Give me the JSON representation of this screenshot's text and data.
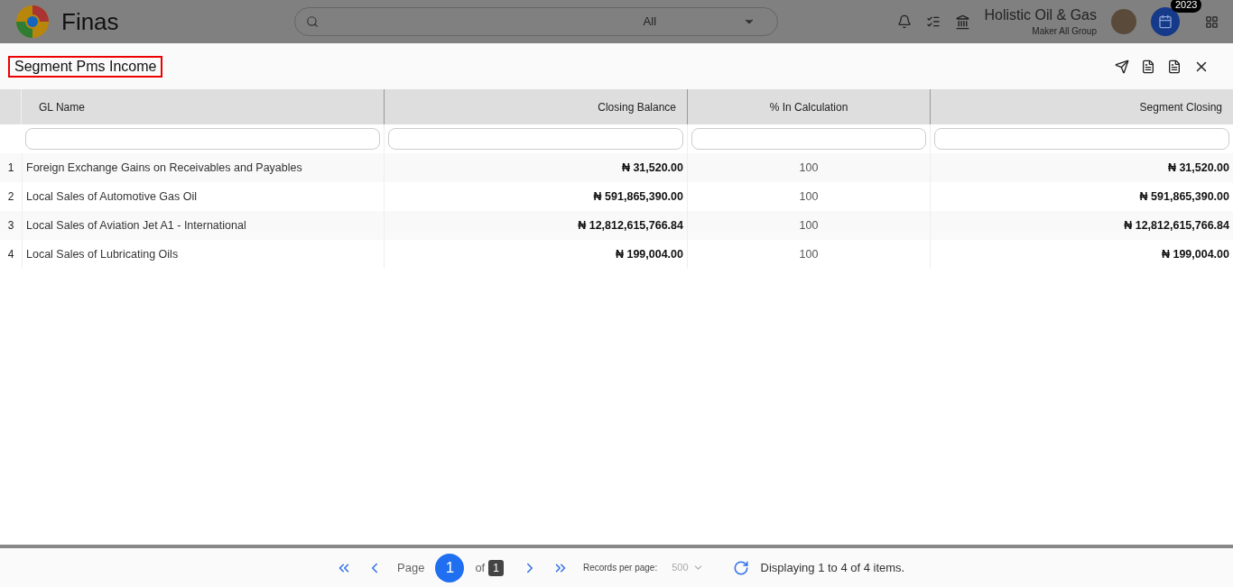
{
  "app": {
    "name": "Finas"
  },
  "search": {
    "scope": "All"
  },
  "company": {
    "name": "Holistic Oil & Gas",
    "group": "Maker All Group"
  },
  "year_badge": "2023",
  "panel": {
    "title": "Segment Pms Income"
  },
  "table": {
    "columns": [
      {
        "label": "GL Name",
        "kind": "text"
      },
      {
        "label": "Closing Balance",
        "kind": "amount"
      },
      {
        "label": "% In Calculation",
        "kind": "percent"
      },
      {
        "label": "Segment Closing",
        "kind": "amount"
      }
    ],
    "rows": [
      {
        "index": "1",
        "cells": [
          "Foreign Exchange Gains on Receivables and Payables",
          "₦ 31,520.00",
          "100",
          "₦ 31,520.00"
        ]
      },
      {
        "index": "2",
        "cells": [
          "Local Sales of Automotive Gas Oil",
          "₦ 591,865,390.00",
          "100",
          "₦ 591,865,390.00"
        ]
      },
      {
        "index": "3",
        "cells": [
          "Local Sales of Aviation Jet A1 - International",
          "₦ 12,812,615,766.84",
          "100",
          "₦ 12,812,615,766.84"
        ]
      },
      {
        "index": "4",
        "cells": [
          "Local Sales of Lubricating Oils",
          "₦ 199,004.00",
          "100",
          "₦ 199,004.00"
        ]
      }
    ]
  },
  "pager": {
    "page_label": "Page",
    "page": "1",
    "of_label": "of",
    "total_pages": "1",
    "records_label": "Records per page:",
    "records_value": "500",
    "status": "Displaying 1 to 4 of 4 items."
  }
}
